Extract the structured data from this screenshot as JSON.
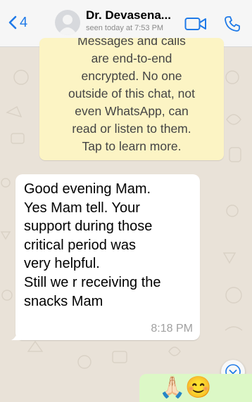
{
  "header": {
    "back_count": "4",
    "contact_name": "Dr. Devasena...",
    "last_seen": "seen today at 7:53 PM"
  },
  "encryption_notice": {
    "lines": [
      "Messages and calls",
      "are end-to-end",
      "encrypted. No one",
      "outside of this chat, not",
      "even WhatsApp, can",
      "read or listen to them.",
      "Tap to learn more."
    ]
  },
  "incoming_message": {
    "lines": [
      "Good evening Mam.",
      "Yes Mam tell. Your",
      "support during those",
      "critical period was",
      "very  helpful.",
      "Still we r receiving the",
      "snacks Mam"
    ],
    "time": "8:18 PM"
  },
  "outgoing_message": {
    "text": "🙏🏻😊"
  },
  "colors": {
    "accent": "#1f7ae8",
    "chat_bg": "#e9e2d8",
    "incoming_bubble": "#ffffff",
    "outgoing_bubble": "#dcf8c6",
    "system_bubble": "#fcf4c4"
  }
}
